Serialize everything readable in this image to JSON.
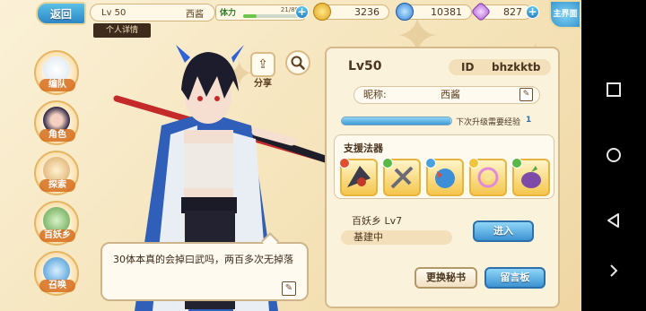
{
  "topbar": {
    "back_label": "返回",
    "level": "Lv 50",
    "player_name": "西酱",
    "stamina_label": "体力",
    "stamina_value": "21/89",
    "stamina_fraction": 0.24,
    "gold": "3236",
    "gems": "10381",
    "crystals": "827",
    "main_label": "主界面",
    "tab_detail": "个人详情"
  },
  "nav": {
    "items": [
      {
        "label": "编队"
      },
      {
        "label": "角色"
      },
      {
        "label": "探索"
      },
      {
        "label": "百妖乡"
      },
      {
        "label": "召唤"
      }
    ]
  },
  "actions": {
    "share_label": "分享"
  },
  "speech": {
    "text": "30体本真的会掉曰武吗，两百多次无掉落"
  },
  "panel": {
    "level": "Lv50",
    "id_label": "ID",
    "id_value": "bhzkktb",
    "nickname_label": "昵称:",
    "nickname_value": "西酱",
    "exp_label": "下次升级需要经验",
    "exp_value": "1",
    "exp_fraction": 0.99,
    "support_title": "支援法器",
    "town_name": "百妖乡  Lv7",
    "town_status": "基建中",
    "enter_label": "进入",
    "change_secret_label": "更换秘书",
    "message_board_label": "留言板"
  },
  "colors": {
    "accent_blue": "#3d93d2",
    "panel_bg": "#fbf2dc",
    "gold_trim": "#e8b43b"
  }
}
